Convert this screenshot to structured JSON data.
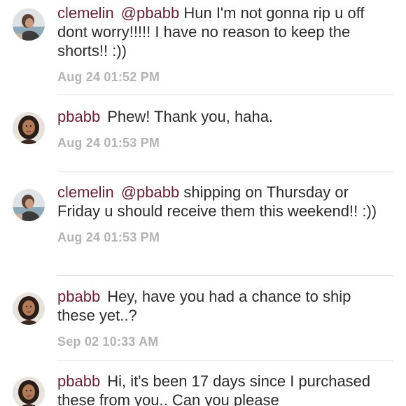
{
  "comments": [
    {
      "user": "clemelin",
      "mention": "@pbabb",
      "text": "Hun I'm not gonna rip u off dont worry!!!!! I have no reason to keep the shorts!! :))",
      "timestamp": "Aug 24 01:52 PM",
      "avatar": "avatar-clemelin"
    },
    {
      "user": "pbabb",
      "mention": "",
      "text": "Phew! Thank you, haha.",
      "timestamp": "Aug 24 01:53 PM",
      "avatar": "avatar-pbabb"
    },
    {
      "user": "clemelin",
      "mention": "@pbabb",
      "text": "shipping on Thursday or Friday u should receive them this weekend!! :))",
      "timestamp": "Aug 24 01:53 PM",
      "avatar": "avatar-clemelin"
    },
    {
      "user": "pbabb",
      "mention": "",
      "text": "Hey, have you had a chance to ship these yet..?",
      "timestamp": "Sep 02 10:33 AM",
      "avatar": "avatar-pbabb"
    },
    {
      "user": "pbabb",
      "mention": "",
      "text": "Hi, it's been 17 days since I purchased these from you.. Can you please",
      "timestamp": "",
      "avatar": "avatar-pbabb"
    }
  ],
  "colors": {
    "username": "#6e1f37",
    "text": "#2b2b2b",
    "timestamp": "#b3b3b3",
    "divider": "#e2e2e2"
  }
}
